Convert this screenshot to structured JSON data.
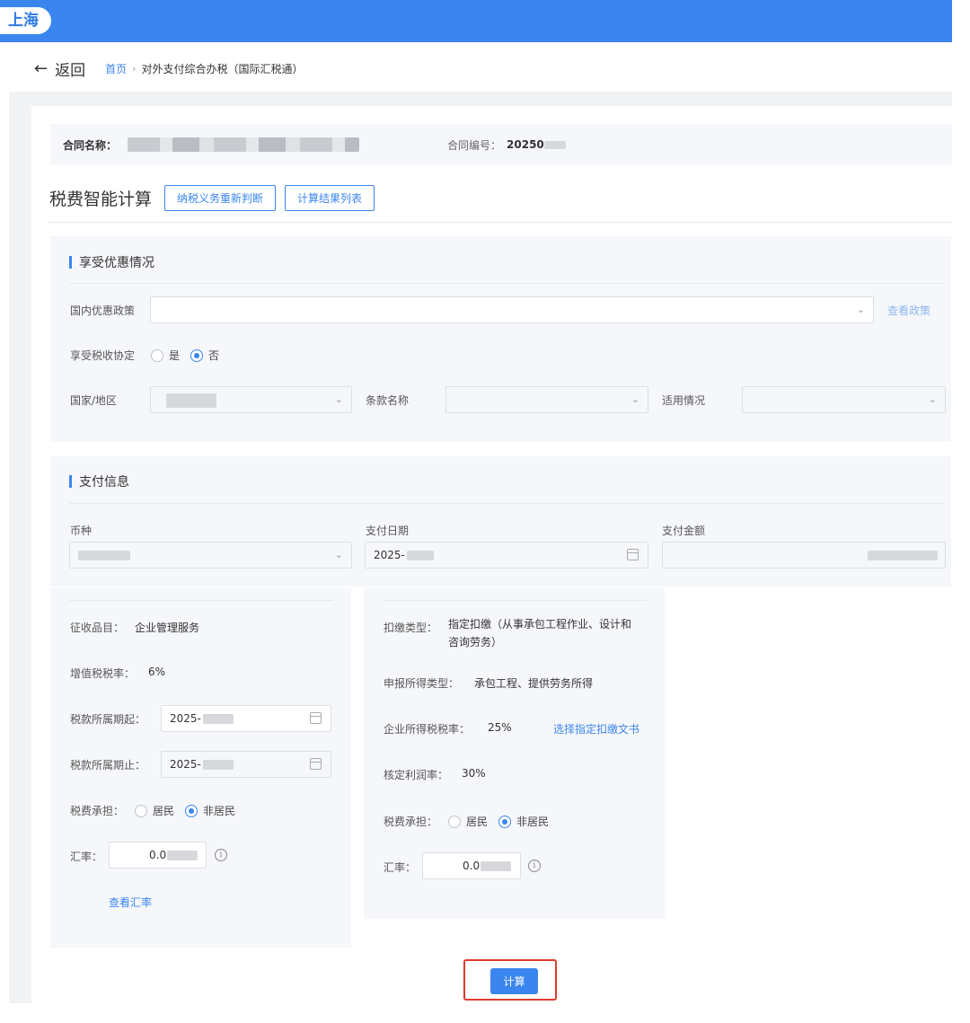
{
  "header": {
    "city": "上海"
  },
  "nav": {
    "back": "返回",
    "breadcrumb_home": "首页",
    "breadcrumb_separator": "›",
    "breadcrumb_current": "对外支付综合办税（国际汇税通）"
  },
  "contract": {
    "name_label": "合同名称：",
    "number_label": "合同编号：",
    "number_value": "20250"
  },
  "calc": {
    "title": "税费智能计算",
    "redetermine_btn": "纳税义务重新判断",
    "result_list_btn": "计算结果列表"
  },
  "preferential": {
    "section_title": "享受优惠情况",
    "domestic_policy_label": "国内优惠政策",
    "view_policy_link": "查看政策",
    "treaty_label": "享受税收协定",
    "treaty_options": [
      "是",
      "否"
    ],
    "treaty_selected": "否",
    "country_label": "国家/地区",
    "clause_label": "条款名称",
    "applicable_label": "适用情况"
  },
  "payment": {
    "section_title": "支付信息",
    "currency_label": "币种",
    "currency_value": "",
    "date_label": "支付日期",
    "date_value": "2025-",
    "amount_label": "支付金额"
  },
  "left_panel": {
    "item_label": "征收品目：",
    "item_value": "企业管理服务",
    "vat_label": "增值税税率：",
    "vat_value": "6%",
    "period_start_label": "税款所属期起：",
    "period_start_value": "2025-",
    "period_end_label": "税款所属期止：",
    "period_end_value": "2025-",
    "tax_bearer_label": "税费承担：",
    "tax_bearer_options": [
      "居民",
      "非居民"
    ],
    "tax_bearer_selected": "非居民",
    "rate_label": "汇率：",
    "rate_value": "0.0",
    "view_rate_link": "查看汇率"
  },
  "right_panel": {
    "withholding_type_label": "扣缴类型：",
    "withholding_type_value_line1": "指定扣缴（从事承包工程作业、设计和",
    "withholding_type_value_line2": "咨询劳务）",
    "income_type_label": "申报所得类型：",
    "income_type_value": "承包工程、提供劳务所得",
    "cit_rate_label": "企业所得税税率：",
    "cit_rate_value": "25%",
    "select_doc_link": "选择指定扣缴文书",
    "profit_rate_label": "核定利润率：",
    "profit_rate_value": "30%",
    "tax_bearer_label": "税费承担：",
    "tax_bearer_options": [
      "居民",
      "非居民"
    ],
    "tax_bearer_selected": "非居民",
    "rate_label": "汇率：",
    "rate_value": "0.0"
  },
  "footer": {
    "calculate_btn": "计算"
  },
  "colors": {
    "accent": "#3b86ee",
    "highlight": "#e03b2e",
    "panel_bg": "#f5f7fa"
  },
  "icons": {
    "back": "arrow-left-icon",
    "dropdown": "chevron-down-icon",
    "calendar": "calendar-icon",
    "info": "info-icon"
  }
}
